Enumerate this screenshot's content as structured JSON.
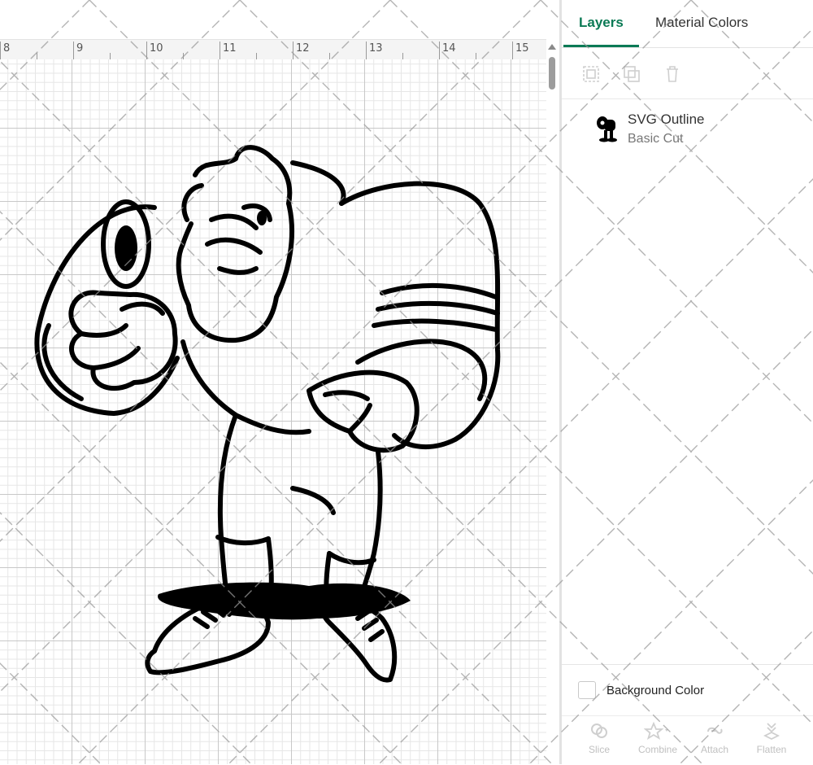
{
  "ruler": {
    "labels": [
      "8",
      "9",
      "10",
      "11",
      "12",
      "13",
      "14",
      "15"
    ]
  },
  "panel": {
    "tabs": [
      {
        "label": "Layers",
        "active": true
      },
      {
        "label": "Material Colors",
        "active": false
      }
    ],
    "toolbar_icons": [
      "group-icon",
      "duplicate-icon",
      "delete-icon"
    ],
    "layers": [
      {
        "name": "SVG Outline",
        "operation": "Basic Cut"
      }
    ],
    "background_color": {
      "label": "Background Color",
      "checked": false
    },
    "bottom_actions": [
      {
        "label": "Slice",
        "icon": "slice-icon"
      },
      {
        "label": "Combine",
        "icon": "combine-icon"
      },
      {
        "label": "Attach",
        "icon": "attach-icon"
      },
      {
        "label": "Flatten",
        "icon": "flatten-icon"
      }
    ]
  },
  "colors": {
    "accent": "#0b7a55",
    "disabled": "#c0c0c0",
    "artwork": "#000000"
  }
}
